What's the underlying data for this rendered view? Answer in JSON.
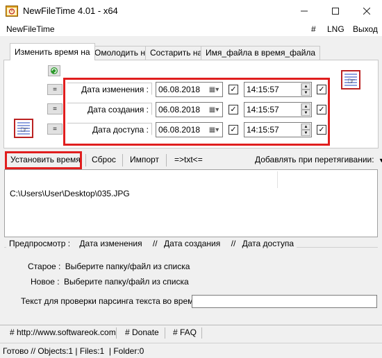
{
  "window": {
    "title": "NewFileTime 4.01 - x64",
    "minimize": "—",
    "maximize": "☐",
    "close": "✕"
  },
  "menu": {
    "app_name": "NewFileTime",
    "hash": "#",
    "lng": "LNG",
    "exit": "Выход"
  },
  "tabs": [
    {
      "label": "Изменить время на",
      "active": true
    },
    {
      "label": "Омолодить на",
      "active": false
    },
    {
      "label": "Состарить на",
      "active": false
    },
    {
      "label": "Имя_файла в время_файла",
      "active": false
    }
  ],
  "rows": [
    {
      "eq": "=",
      "label": "Дата изменения :",
      "date": "06.08.2018",
      "time": "14:15:57"
    },
    {
      "eq": "=",
      "label": "Дата создания :",
      "date": "06.08.2018",
      "time": "14:15:57"
    },
    {
      "eq": "=",
      "label": "Дата доступа :",
      "date": "06.08.2018",
      "time": "14:15:57"
    }
  ],
  "toolbar": {
    "set_time": "Установить время",
    "reset": "Сброс",
    "import": "Импорт",
    "txt": "=>txt<=",
    "on_drag": "Добавлять при перетягивании:",
    "on_drag_arrow": "▼"
  },
  "list": {
    "items": [
      "C:\\Users\\User\\Desktop\\035.JPG"
    ]
  },
  "preview": {
    "label": "Предпросмотр  :",
    "col1": "Дата изменения",
    "sep1": "//",
    "col2": "Дата создания",
    "sep2": "//",
    "col3": "Дата доступа",
    "old_label": "Старое :",
    "old_value": "Выберите папку/файл из списка",
    "new_label": "Новое :",
    "new_value": "Выберите папку/файл из списка"
  },
  "parse": {
    "label": "Текст для проверки парсинга текста во время",
    "value": ""
  },
  "links": {
    "site": "# http://www.softwareok.com",
    "donate": "# Donate",
    "faq": "# FAQ"
  },
  "status": {
    "text": "Готово // Objects:1 | Files:1  | Folder:0"
  },
  "colors": {
    "highlight": "#e01e1e"
  }
}
